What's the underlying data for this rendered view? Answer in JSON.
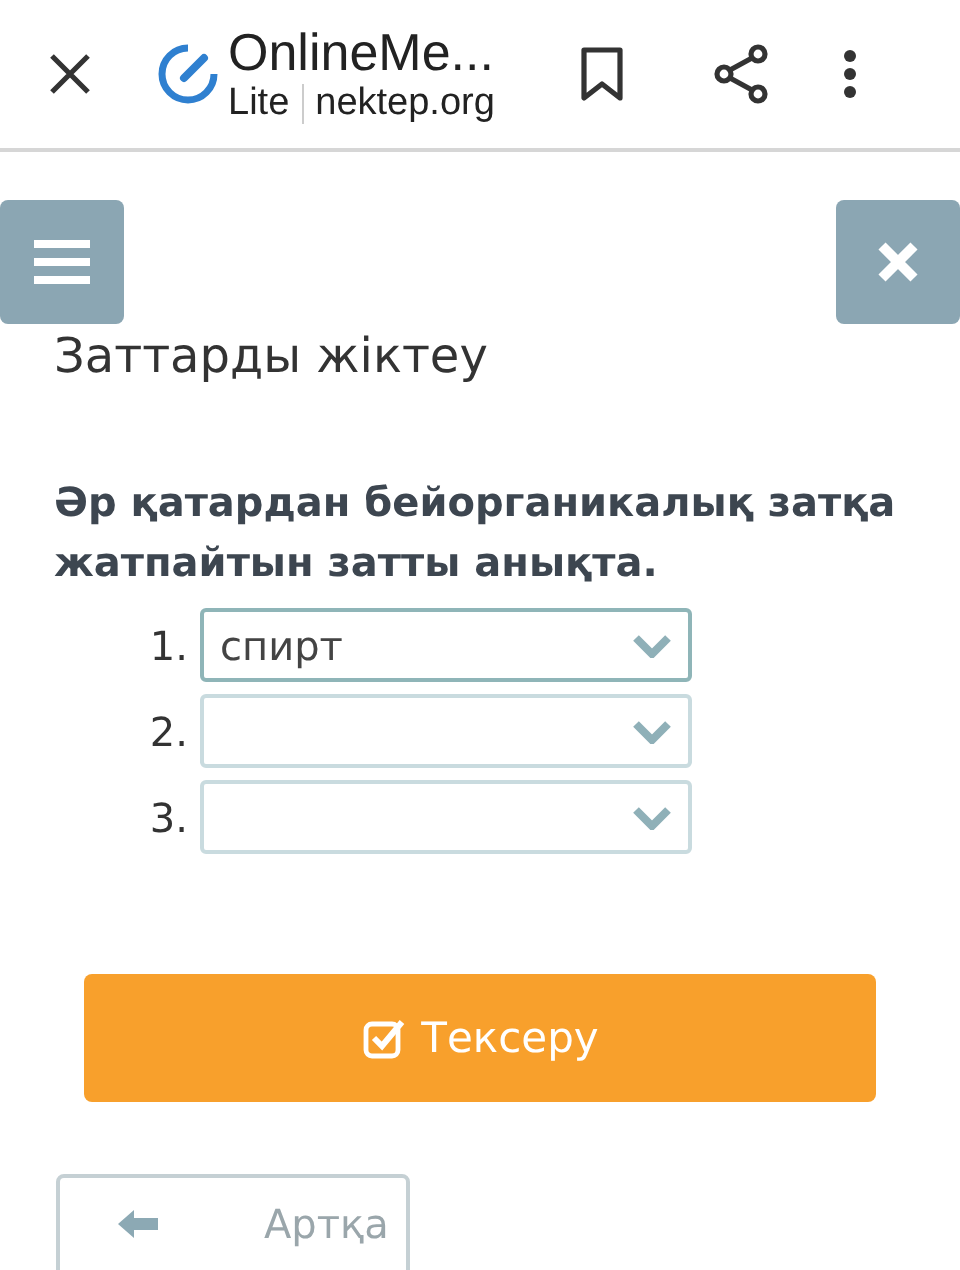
{
  "browser_bar": {
    "title": "OnlineMe...",
    "mode": "Lite",
    "domain": "nektep.org"
  },
  "heading": "Заттарды жіктеу",
  "question": "Әр қатардан бейорганикалық затқа жатпайтын затты анықта.",
  "answers": [
    {
      "number": "1.",
      "value": "спирт"
    },
    {
      "number": "2."
    },
    {
      "number": "3."
    }
  ],
  "check_button": "Тексеру",
  "back_button": "Артқа"
}
